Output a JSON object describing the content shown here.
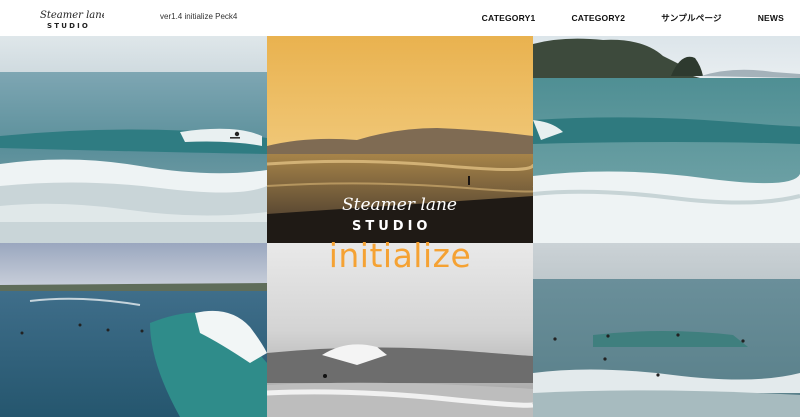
{
  "header": {
    "logo_script": "Steamer lane",
    "logo_word": "STUDIO",
    "version": "ver1.4 initialize Peck4",
    "nav": [
      {
        "label": "CATEGORY1"
      },
      {
        "label": "CATEGORY2"
      },
      {
        "label": "サンプルページ"
      },
      {
        "label": "NEWS"
      }
    ]
  },
  "overlay": {
    "logo_script": "Steamer lane",
    "logo_word": "STUDIO",
    "word": "initialize"
  },
  "colors": {
    "accent": "#f5a233",
    "sea": "#4e8f93",
    "sunset": "#e8b250"
  }
}
